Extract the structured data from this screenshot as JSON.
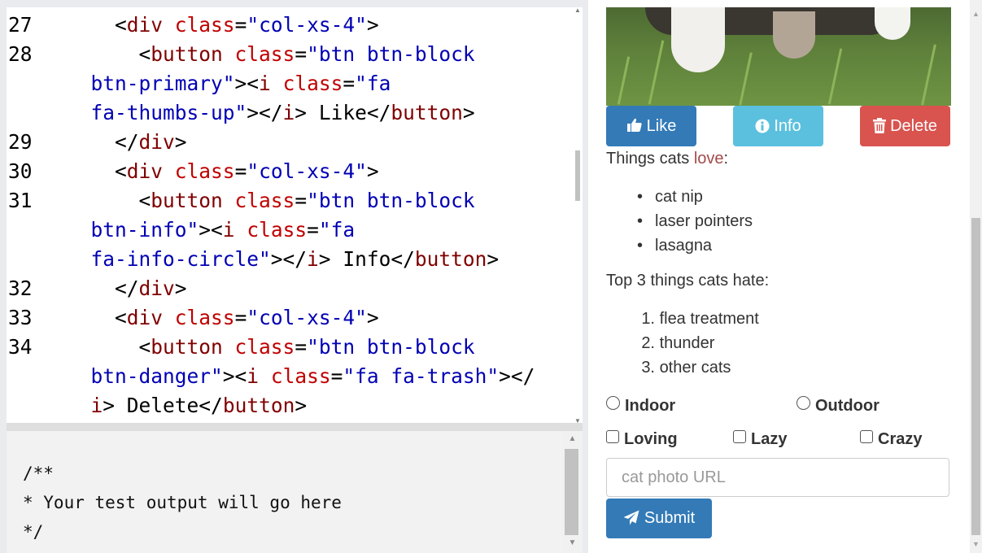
{
  "editor": {
    "lines": [
      {
        "n": "27",
        "tokens": [
          [
            "punc",
            "    <"
          ],
          [
            "tag",
            "div"
          ],
          [
            "punc",
            " "
          ],
          [
            "attr",
            "class"
          ],
          [
            "punc",
            "="
          ],
          [
            "str",
            "\"col-xs-4\""
          ],
          [
            "punc",
            ">"
          ]
        ]
      },
      {
        "n": "28",
        "tokens": [
          [
            "punc",
            "      <"
          ],
          [
            "tag",
            "button"
          ],
          [
            "punc",
            " "
          ],
          [
            "attr",
            "class"
          ],
          [
            "punc",
            "="
          ],
          [
            "str",
            "\"btn btn-block"
          ]
        ]
      },
      {
        "n": "",
        "tokens": [
          [
            "str",
            "  btn-primary\""
          ],
          [
            "punc",
            "><"
          ],
          [
            "tag",
            "i"
          ],
          [
            "punc",
            " "
          ],
          [
            "attr",
            "class"
          ],
          [
            "punc",
            "="
          ],
          [
            "str",
            "\"fa"
          ]
        ]
      },
      {
        "n": "",
        "tokens": [
          [
            "str",
            "  fa-thumbs-up\""
          ],
          [
            "punc",
            "></"
          ],
          [
            "tag",
            "i"
          ],
          [
            "punc",
            "> "
          ],
          [
            "text",
            "Like"
          ],
          [
            "punc",
            "</"
          ],
          [
            "tag",
            "button"
          ],
          [
            "punc",
            ">"
          ]
        ]
      },
      {
        "n": "29",
        "tokens": [
          [
            "punc",
            "    </"
          ],
          [
            "tag",
            "div"
          ],
          [
            "punc",
            ">"
          ]
        ]
      },
      {
        "n": "30",
        "tokens": [
          [
            "punc",
            "    <"
          ],
          [
            "tag",
            "div"
          ],
          [
            "punc",
            " "
          ],
          [
            "attr",
            "class"
          ],
          [
            "punc",
            "="
          ],
          [
            "str",
            "\"col-xs-4\""
          ],
          [
            "punc",
            ">"
          ]
        ]
      },
      {
        "n": "31",
        "tokens": [
          [
            "punc",
            "      <"
          ],
          [
            "tag",
            "button"
          ],
          [
            "punc",
            " "
          ],
          [
            "attr",
            "class"
          ],
          [
            "punc",
            "="
          ],
          [
            "str",
            "\"btn btn-block"
          ]
        ]
      },
      {
        "n": "",
        "tokens": [
          [
            "str",
            "  btn-info\""
          ],
          [
            "punc",
            "><"
          ],
          [
            "tag",
            "i"
          ],
          [
            "punc",
            " "
          ],
          [
            "attr",
            "class"
          ],
          [
            "punc",
            "="
          ],
          [
            "str",
            "\"fa"
          ]
        ]
      },
      {
        "n": "",
        "tokens": [
          [
            "str",
            "  fa-info-circle\""
          ],
          [
            "punc",
            "></"
          ],
          [
            "tag",
            "i"
          ],
          [
            "punc",
            "> "
          ],
          [
            "text",
            "Info"
          ],
          [
            "punc",
            "</"
          ],
          [
            "tag",
            "button"
          ],
          [
            "punc",
            ">"
          ]
        ]
      },
      {
        "n": "32",
        "tokens": [
          [
            "punc",
            "    </"
          ],
          [
            "tag",
            "div"
          ],
          [
            "punc",
            ">"
          ]
        ]
      },
      {
        "n": "33",
        "tokens": [
          [
            "punc",
            "    <"
          ],
          [
            "tag",
            "div"
          ],
          [
            "punc",
            " "
          ],
          [
            "attr",
            "class"
          ],
          [
            "punc",
            "="
          ],
          [
            "str",
            "\"col-xs-4\""
          ],
          [
            "punc",
            ">"
          ]
        ]
      },
      {
        "n": "34",
        "tokens": [
          [
            "punc",
            "      <"
          ],
          [
            "tag",
            "button"
          ],
          [
            "punc",
            " "
          ],
          [
            "attr",
            "class"
          ],
          [
            "punc",
            "="
          ],
          [
            "str",
            "\"btn btn-block"
          ]
        ]
      },
      {
        "n": "",
        "tokens": [
          [
            "str",
            "  btn-danger\""
          ],
          [
            "punc",
            "><"
          ],
          [
            "tag",
            "i"
          ],
          [
            "punc",
            " "
          ],
          [
            "attr",
            "class"
          ],
          [
            "punc",
            "="
          ],
          [
            "str",
            "\"fa fa-trash\""
          ],
          [
            "punc",
            "></"
          ]
        ]
      },
      {
        "n": "",
        "tokens": [
          [
            "tag",
            "  i"
          ],
          [
            "punc",
            "> "
          ],
          [
            "text",
            "Delete"
          ],
          [
            "punc",
            "</"
          ],
          [
            "tag",
            "button"
          ],
          [
            "punc",
            ">"
          ]
        ]
      }
    ]
  },
  "output": {
    "lines": [
      "/**",
      "* Your test output will go here",
      "*/"
    ]
  },
  "preview": {
    "like_label": "Like",
    "info_label": "Info",
    "delete_label": "Delete",
    "love_prefix": "Things cats ",
    "love_word": "love",
    "love_suffix": ":",
    "love_items": [
      "cat nip",
      "laser pointers",
      "lasagna"
    ],
    "hate_title": "Top 3 things cats hate:",
    "hate_items": [
      "flea treatment",
      "thunder",
      "other cats"
    ],
    "radio_indoor": "Indoor",
    "radio_outdoor": "Outdoor",
    "check_loving": "Loving",
    "check_lazy": "Lazy",
    "check_crazy": "Crazy",
    "url_placeholder": "cat photo URL",
    "submit_label": "Submit"
  },
  "icons": {
    "like": "thumbs-up-icon",
    "info": "info-circle-icon",
    "delete": "trash-icon",
    "submit": "paper-plane-icon"
  },
  "colors": {
    "primary": "#337ab7",
    "info": "#5bc0de",
    "danger": "#d9534f",
    "love_word": "#a54a4a"
  }
}
